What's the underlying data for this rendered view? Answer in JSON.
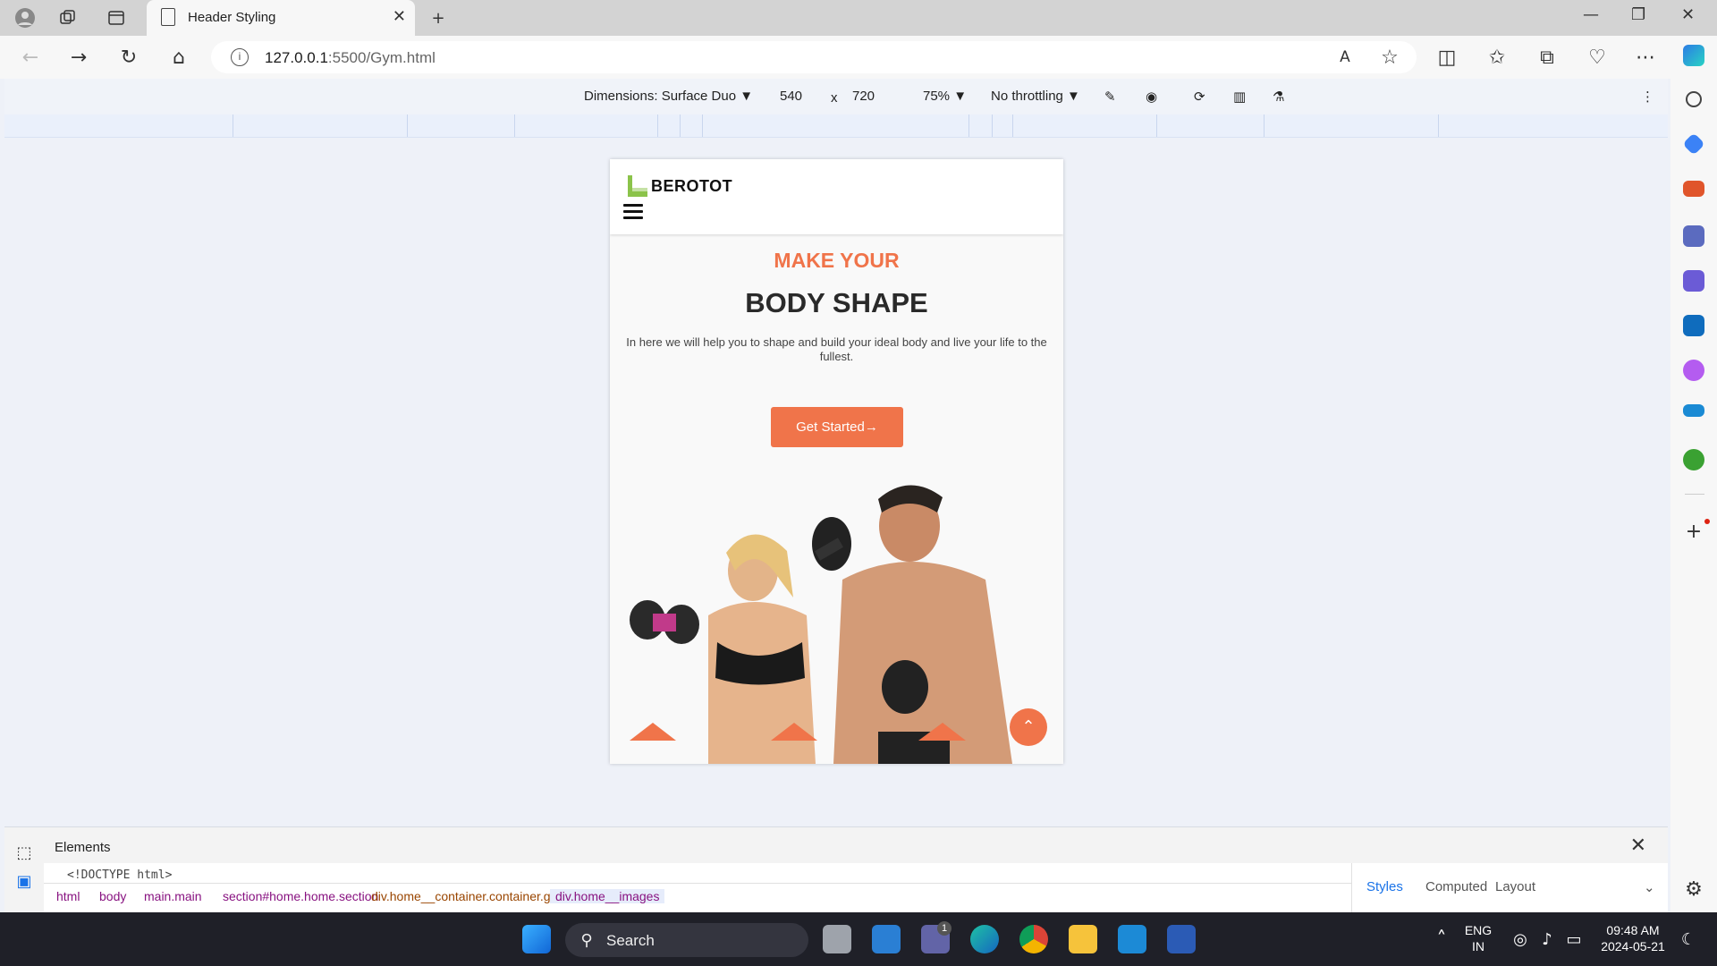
{
  "browser": {
    "tab_title": "Header Styling",
    "url_host": "127.0.0.1",
    "url_path": ":5500/Gym.html"
  },
  "devtools_toolbar": {
    "dimensions": "Dimensions: Surface Duo",
    "width": "540",
    "times": "x",
    "height": "720",
    "zoom": "75%",
    "throttling": "No throttling"
  },
  "site": {
    "logo_text": "BEROTOT",
    "hero_sub": "MAKE YOUR",
    "hero_title": "BODY SHAPE",
    "hero_desc": "In here we will help you to shape and build your ideal body and live your life to the fullest.",
    "cta_label": "Get Started"
  },
  "devtools_panel": {
    "title": "Elements",
    "code_line": "<!DOCTYPE html>",
    "breadcrumbs": [
      {
        "label": "html",
        "color": "#881280"
      },
      {
        "label": "body",
        "color": "#881280"
      },
      {
        "label": "main.main",
        "color": "#881280"
      },
      {
        "label": "section#home.home.section",
        "color": "#881280"
      },
      {
        "label": "div.home__container.container.grid",
        "color": "#994500"
      },
      {
        "label": "div.home__images",
        "color": "#881280"
      }
    ],
    "tabs": [
      "Styles",
      "Computed",
      "Layout"
    ]
  },
  "taskbar": {
    "search": "Search",
    "lang1": "ENG",
    "lang2": "IN",
    "time": "09:48 AM",
    "date": "2024-05-21",
    "teams_badge": "1"
  },
  "colors": {
    "accent": "#f0744a",
    "logo_green": "#8bc34a"
  }
}
